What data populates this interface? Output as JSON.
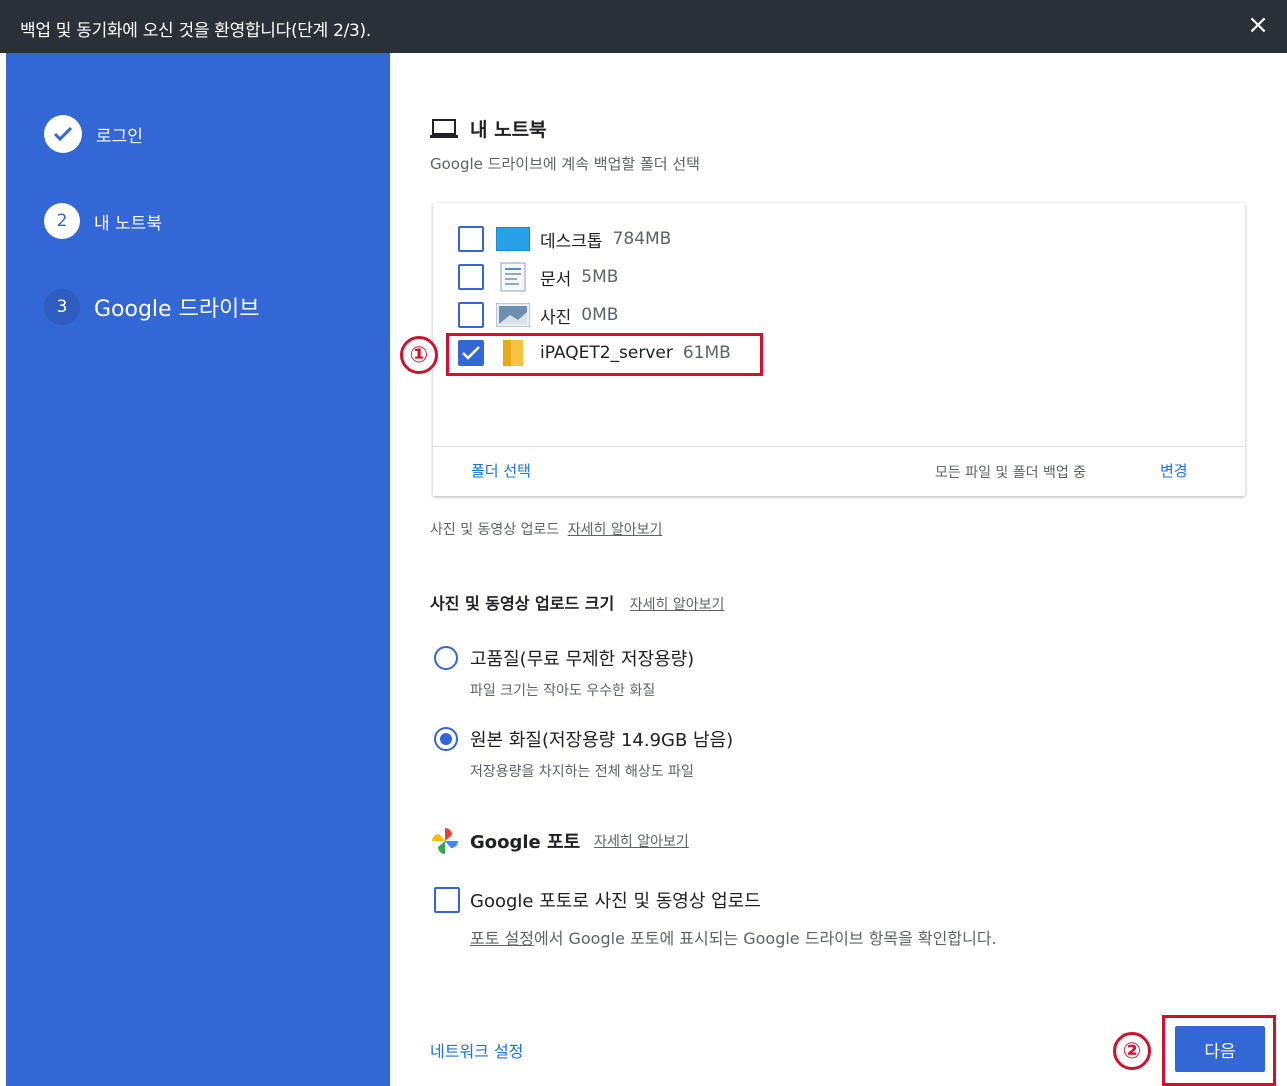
{
  "window": {
    "title": "백업 및 동기화에 오신 것을 환영합니다(단계 2/3).",
    "close_icon": "×"
  },
  "sidebar": {
    "steps": [
      {
        "number": "✓",
        "label": "로그인",
        "state": "done"
      },
      {
        "number": "2",
        "label": "내 노트북",
        "state": "current"
      },
      {
        "number": "3",
        "label": "Google 드라이브",
        "state": "future"
      }
    ]
  },
  "main": {
    "title": "내 노트북",
    "subtitle": "Google 드라이브에 계속 백업할 폴더 선택",
    "folders": [
      {
        "name": "데스크톱",
        "size": "784MB",
        "checked": false,
        "icon": "desktop-folder-icon"
      },
      {
        "name": "문서",
        "size": "5MB",
        "checked": false,
        "icon": "documents-folder-icon"
      },
      {
        "name": "사진",
        "size": "0MB",
        "checked": false,
        "icon": "pictures-folder-icon"
      },
      {
        "name": "iPAQET2_server",
        "size": "61MB",
        "checked": true,
        "icon": "yellow-folder-icon"
      }
    ],
    "card_footer": {
      "select_folder": "폴더 선택",
      "status": "모든 파일 및 폴더 백업 중",
      "change": "변경"
    },
    "photo_info": {
      "text": "사진 및 동영상 업로드",
      "link": "자세히 알아보기"
    },
    "upload_size": {
      "title": "사진 및 동영상 업로드 크기",
      "link": "자세히 알아보기",
      "options": [
        {
          "label": "고품질(무료 무제한 저장용량)",
          "desc": "파일 크기는 작아도 우수한 화질",
          "selected": false
        },
        {
          "label": "원본 화질(저장용량 14.9GB 남음)",
          "desc": "저장용량을 차지하는 전체 해상도 파일",
          "selected": true
        }
      ]
    },
    "google_photos": {
      "title": "Google 포토",
      "link": "자세히 알아보기",
      "checkbox_label": "Google 포토로 사진 및 동영상 업로드",
      "desc_link": "포토 설정",
      "desc_text": "에서 Google 포토에 표시되는 Google 드라이브 항목을 확인합니다."
    },
    "network_settings": "네트워크 설정",
    "next_button": "다음"
  },
  "annotations": {
    "badge1": "①",
    "badge2": "②",
    "color": "#d0112b"
  },
  "colors": {
    "sidebar": "#3367d6",
    "titlebar": "#2b3038",
    "accent": "#1a73e8"
  }
}
